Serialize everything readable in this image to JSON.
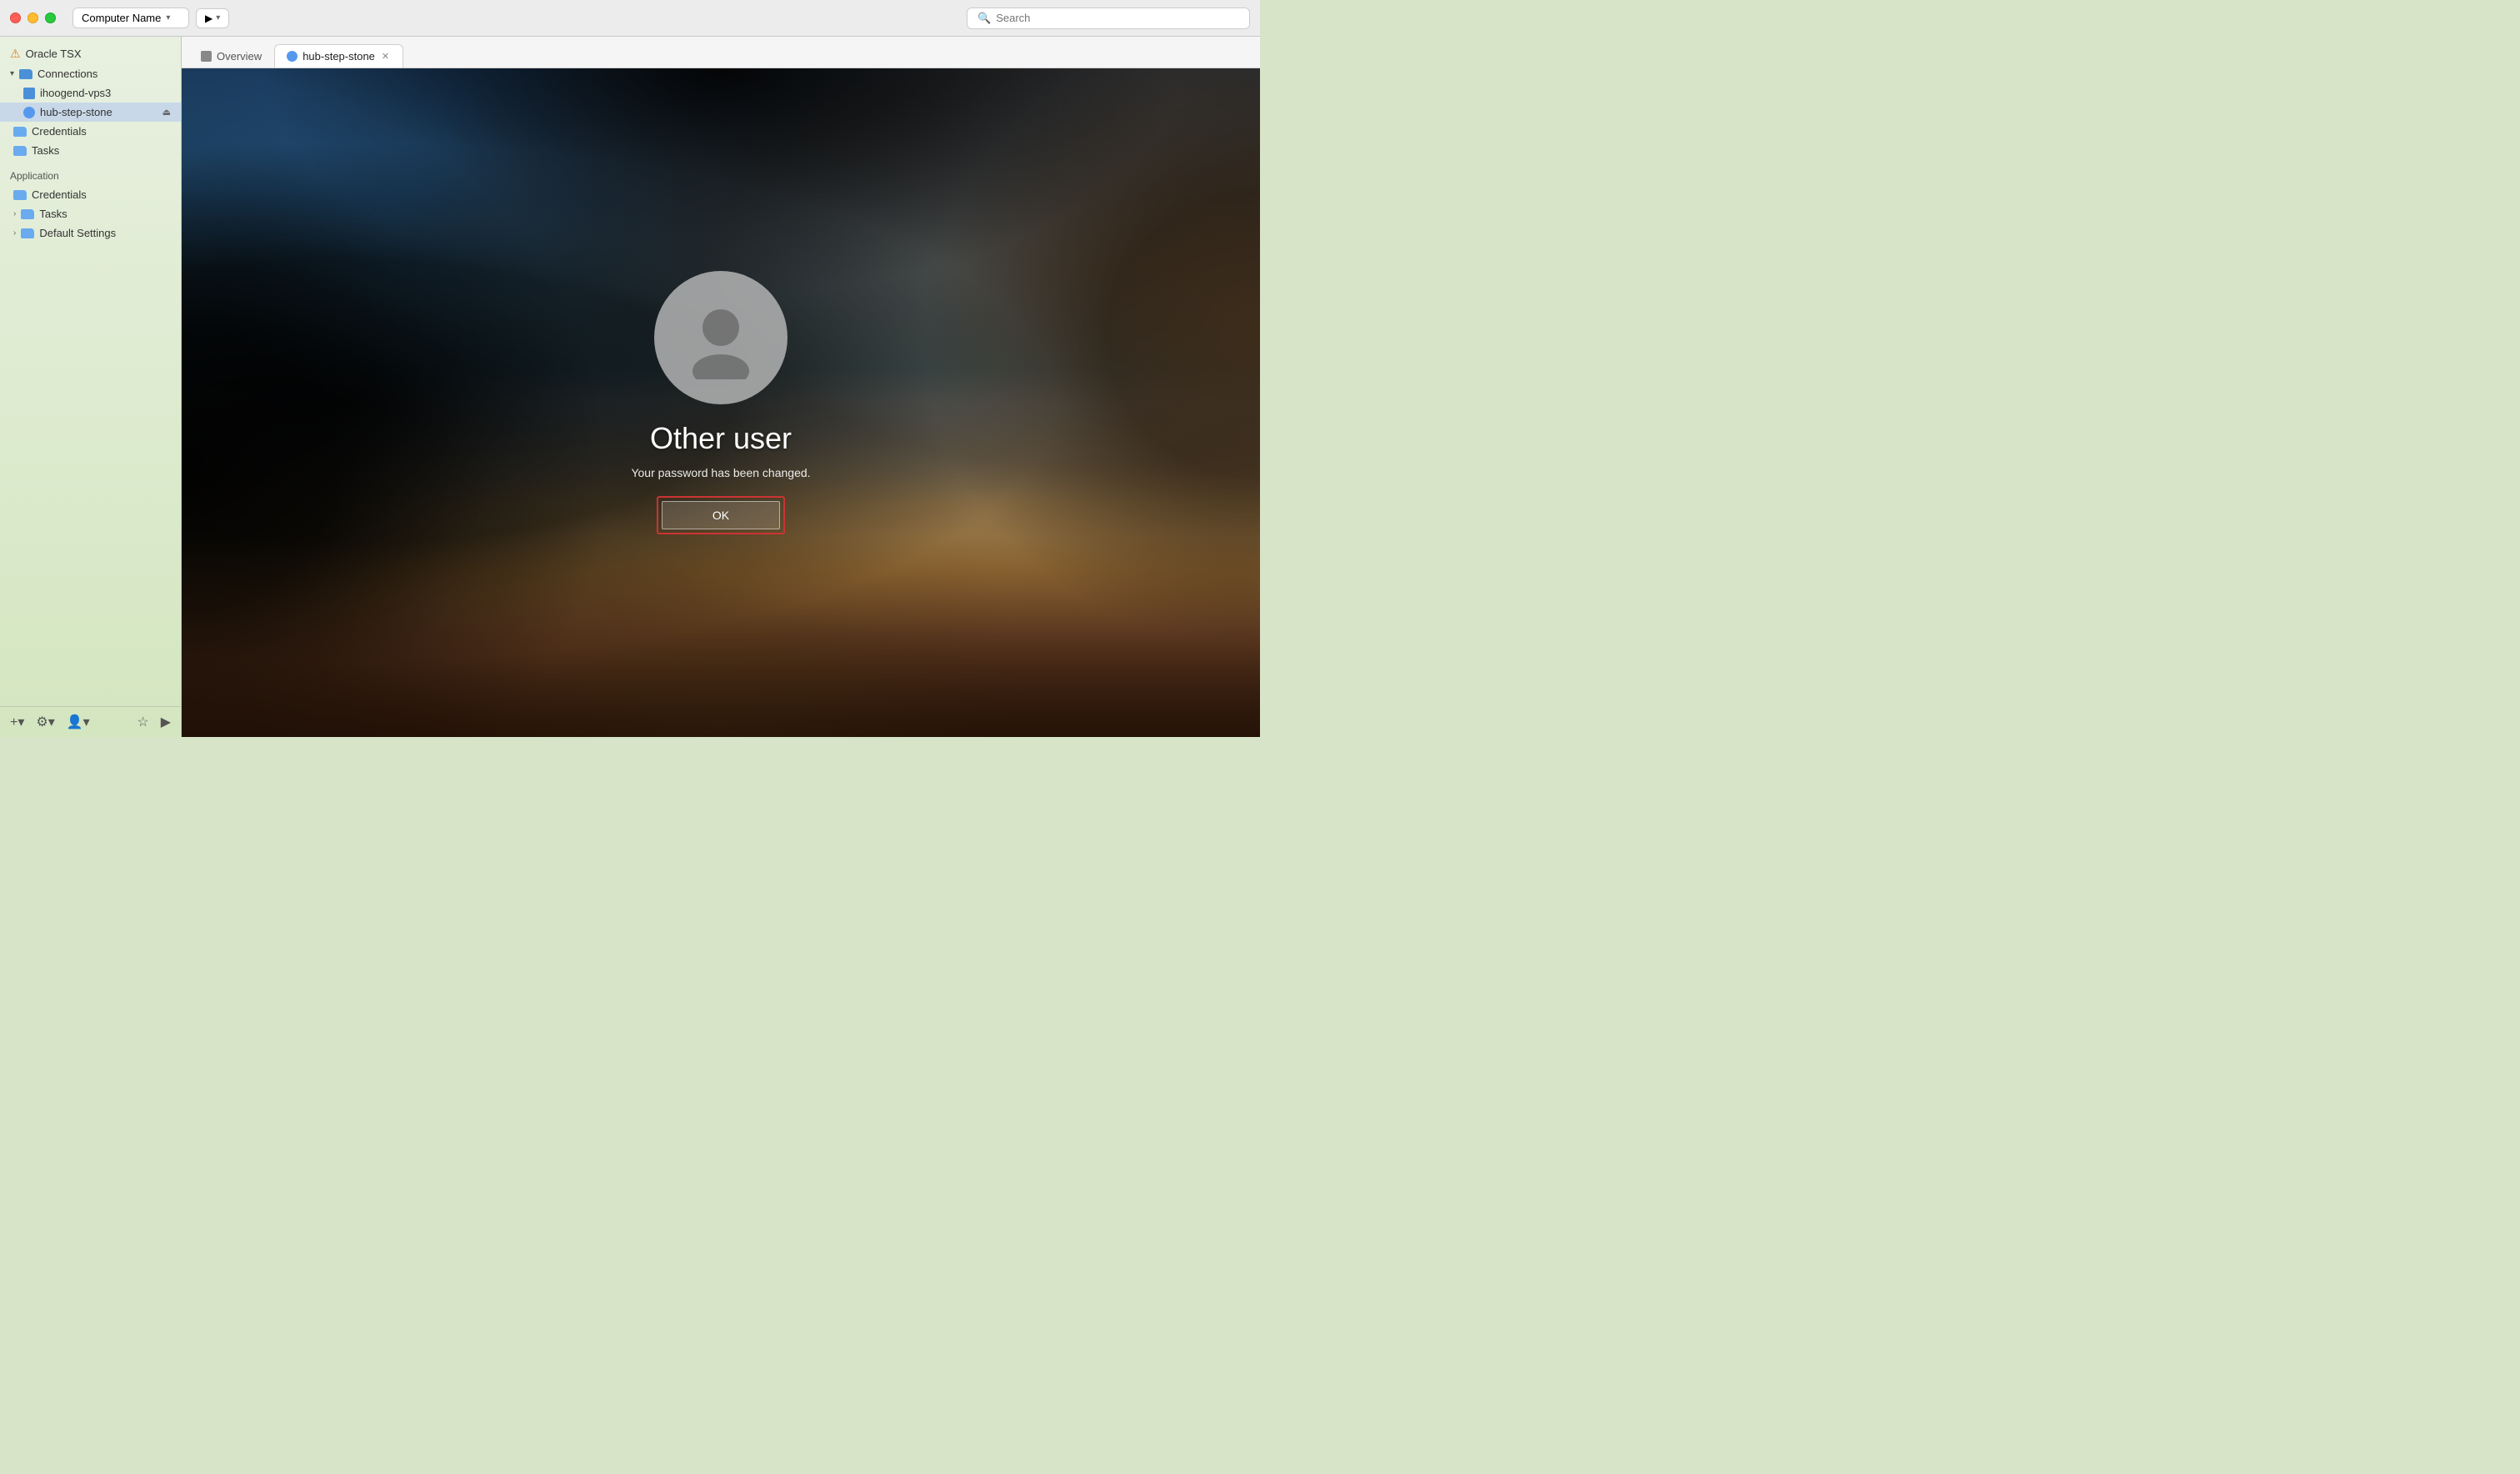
{
  "titlebar": {
    "computer_name": "Computer Name",
    "search_placeholder": "Search"
  },
  "tabs": [
    {
      "id": "overview",
      "label": "Overview",
      "active": false,
      "closable": false
    },
    {
      "id": "hub-step-stone",
      "label": "hub-step-stone",
      "active": true,
      "closable": true
    }
  ],
  "sidebar": {
    "app_name": "Oracle TSX",
    "sections": {
      "connections": {
        "label": "Connections",
        "items": [
          {
            "id": "ihoogend-vps3",
            "label": "ihoogend-vps3",
            "type": "server"
          },
          {
            "id": "hub-step-stone",
            "label": "hub-step-stone",
            "type": "server",
            "active": true
          }
        ]
      },
      "credentials": {
        "label": "Credentials",
        "type": "folder"
      },
      "tasks": {
        "label": "Tasks",
        "type": "folder"
      },
      "application": {
        "label": "Application",
        "items": [
          {
            "id": "app-credentials",
            "label": "Credentials",
            "type": "folder"
          },
          {
            "id": "app-tasks",
            "label": "Tasks",
            "type": "folder"
          },
          {
            "id": "app-default-settings",
            "label": "Default Settings",
            "type": "folder"
          }
        ]
      }
    },
    "bottom_buttons": [
      {
        "id": "add",
        "label": "+"
      },
      {
        "id": "settings",
        "label": "⚙"
      },
      {
        "id": "profile",
        "label": "👤"
      },
      {
        "id": "bookmark",
        "label": "☆"
      },
      {
        "id": "play",
        "label": "▶"
      }
    ]
  },
  "remote_screen": {
    "username": "Other user",
    "message": "Your password has been changed.",
    "ok_button": "OK"
  }
}
